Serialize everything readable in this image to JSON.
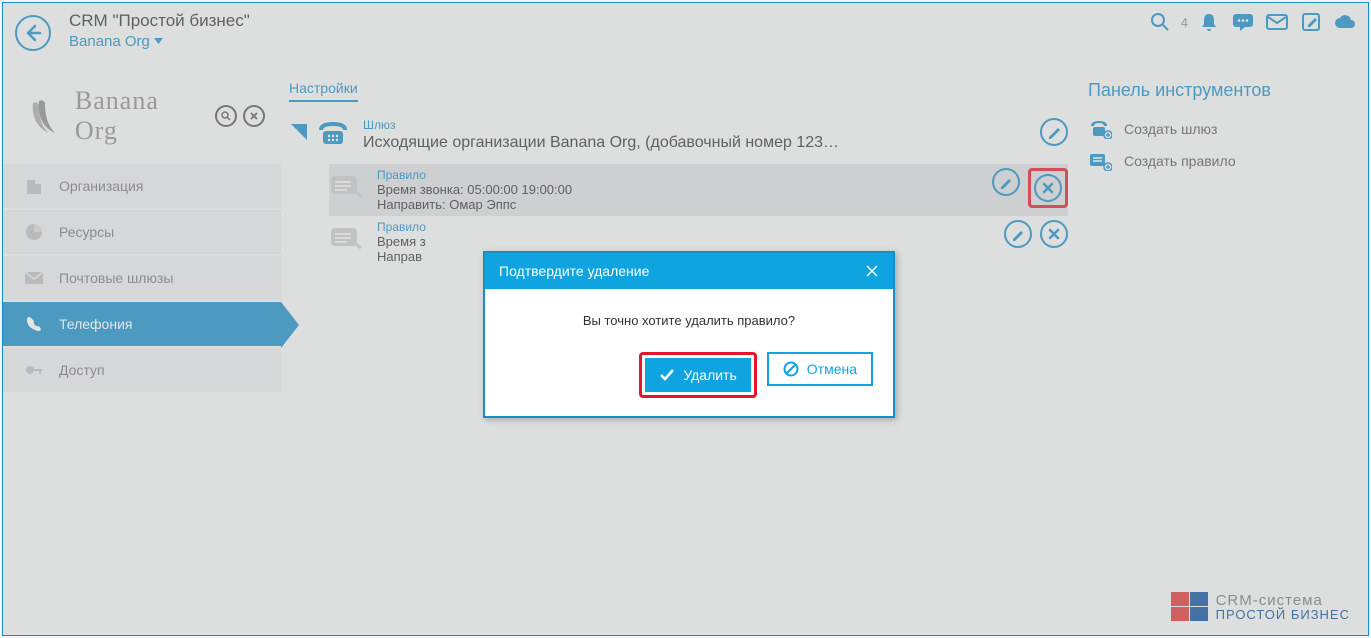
{
  "header": {
    "title": "CRM \"Простой бизнес\"",
    "subtitle": "Banana Org",
    "notif_count": "4"
  },
  "sidebar": {
    "logo_text": "Banana Org",
    "items": [
      {
        "label": "Организация"
      },
      {
        "label": "Ресурсы"
      },
      {
        "label": "Почтовые шлюзы"
      },
      {
        "label": "Телефония"
      },
      {
        "label": "Доступ"
      }
    ]
  },
  "settings": {
    "tab": "Настройки",
    "gateway_label": "Шлюз",
    "gateway_desc": "Исходящие организации Banana Org, (добавочный номер 123…",
    "rules": [
      {
        "label": "Правило",
        "time": "Время звонка: 05:00:00 19:00:00",
        "route": "Направить: Омар Эппс"
      },
      {
        "label": "Правило",
        "time": "Время з",
        "route": "Направ"
      }
    ]
  },
  "tools": {
    "title": "Панель инструментов",
    "items": [
      {
        "label": "Создать шлюз"
      },
      {
        "label": "Создать правило"
      }
    ]
  },
  "modal": {
    "title": "Подтвердите удаление",
    "message": "Вы точно хотите удалить правило?",
    "ok": "Удалить",
    "cancel": "Отмена"
  },
  "footer": {
    "line1": "CRM-система",
    "line2": "ПРОСТОЙ БИЗНЕС"
  }
}
